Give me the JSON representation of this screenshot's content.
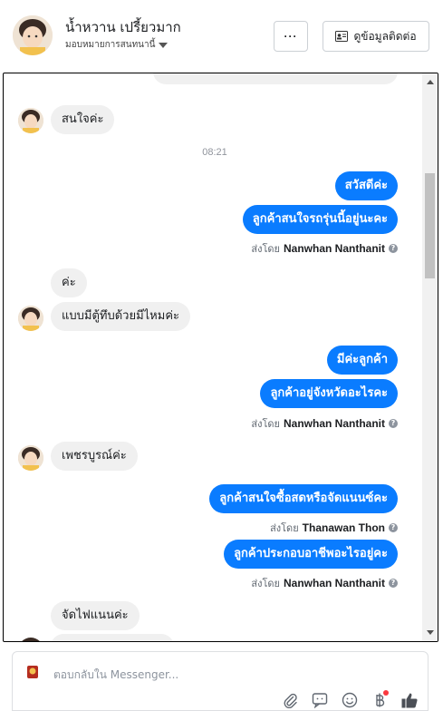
{
  "header": {
    "contact_name": "น้ำหวาน เปรี้ยวมาก",
    "assign_label": "มอบหมายการสนทนานี้",
    "more_label": "···",
    "info_label": "ดูข้อมูลติดต่อ"
  },
  "chat": {
    "messages": [
      {
        "dir": "in",
        "text": "สนใจค่ะ"
      },
      {
        "dir": "time",
        "text": "08:21"
      },
      {
        "dir": "out",
        "text": "สวัสดีค่ะ"
      },
      {
        "dir": "out",
        "text": "ลูกค้าสนใจรถรุ่นนี้อยู่นะคะ"
      },
      {
        "dir": "sentby",
        "prefix": "ส่งโดย",
        "name": "Nanwhan Nanthanit"
      },
      {
        "dir": "in",
        "text": "ค่ะ"
      },
      {
        "dir": "in",
        "text": "แบบมีตู้ทึบด้วยมีไหมค่ะ"
      },
      {
        "dir": "out",
        "text": "มีค่ะลูกค้า"
      },
      {
        "dir": "out",
        "text": "ลูกค้าอยู่จังหวัดอะไรคะ"
      },
      {
        "dir": "sentby",
        "prefix": "ส่งโดย",
        "name": "Nanwhan Nanthanit"
      },
      {
        "dir": "in",
        "text": "เพชรบูรณ์ค่ะ"
      },
      {
        "dir": "out",
        "text": "ลูกค้าสนใจซื้อสดหรือจัดแนนซ์คะ"
      },
      {
        "dir": "sentby",
        "prefix": "ส่งโดย",
        "name": "Thanawan Thon"
      },
      {
        "dir": "out",
        "text": "ลูกค้าประกอบอาชีพอะไรอยู่คะ"
      },
      {
        "dir": "sentby",
        "prefix": "ส่งโดย",
        "name": "Nanwhan Nanthanit"
      },
      {
        "dir": "in",
        "text": "จัดไฟแนนค่ะ"
      }
    ]
  },
  "composer": {
    "placeholder": "ตอบกลับใน Messenger..."
  },
  "icons": [
    "avatar",
    "chevron-down-icon",
    "more-icon",
    "contact-card-icon",
    "help-icon",
    "attach-icon",
    "sticker-icon",
    "emoji-icon",
    "baht-icon",
    "like-icon"
  ],
  "colors": {
    "outgoing_bubble": "#0a7cff",
    "incoming_bubble": "#f0f0f0",
    "notification_dot": "#fa383e"
  }
}
